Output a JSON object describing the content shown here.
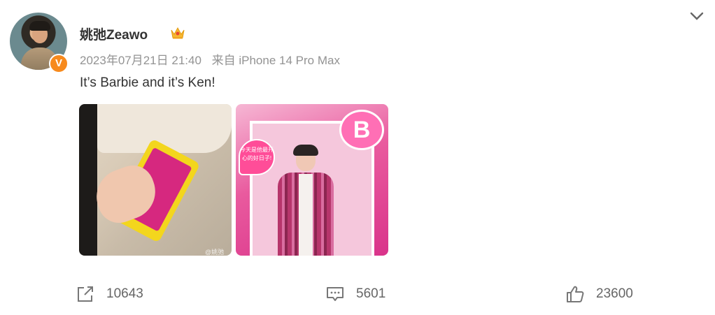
{
  "post": {
    "username": "姚弛Zeawo",
    "date_time": "2023年07月21日 21:40",
    "source": "来自 iPhone 14 Pro Max",
    "text": "It’s Barbie and it’s Ken!",
    "verified_badge": "V"
  },
  "images": [
    {
      "icon": "phone-photo",
      "watermark": "@姚弛Zeawo"
    },
    {
      "icon": "ken-photo",
      "bubble_text": "今天是他最开心的好日子!",
      "logo_text": "B"
    }
  ],
  "actions": {
    "repost_count": "10643",
    "comment_count": "5601",
    "like_count": "23600"
  },
  "colors": {
    "badge": "#f78a1d",
    "text": "#333333",
    "meta": "#939393"
  }
}
